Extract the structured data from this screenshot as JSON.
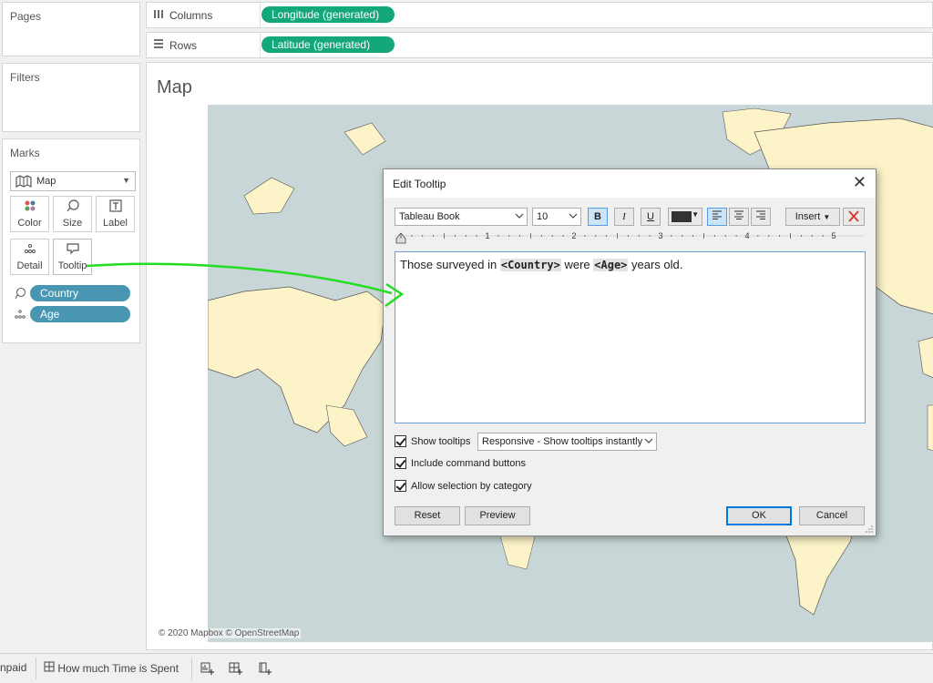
{
  "cards": {
    "pages_title": "Pages",
    "filters_title": "Filters",
    "marks_title": "Marks"
  },
  "marks": {
    "mark_type": "Map",
    "buttons": {
      "color": "Color",
      "size": "Size",
      "label": "Label",
      "detail": "Detail",
      "tooltip": "Tooltip"
    },
    "fields": [
      {
        "name": "Country",
        "encoding": "detail-lasso-icon"
      },
      {
        "name": "Age",
        "encoding": "detail-dots-icon"
      }
    ]
  },
  "shelves": {
    "columns_label": "Columns",
    "columns_pill": "Longitude (generated)",
    "rows_label": "Rows",
    "rows_pill": "Latitude (generated)"
  },
  "viz": {
    "title": "Map",
    "attribution": "© 2020 Mapbox © OpenStreetMap"
  },
  "tabs": {
    "tab1": "npaid",
    "tab2": "How much Time is Spent"
  },
  "dialog": {
    "title": "Edit Tooltip",
    "font": "Tableau Book",
    "font_size": "10",
    "bold": "B",
    "italic": "I",
    "underline": "U",
    "insert": "Insert",
    "ruler_marks": [
      "1",
      "2",
      "3",
      "4",
      "5"
    ],
    "text_parts": {
      "p1": "Those surveyed in ",
      "f1": "<Country>",
      "p2": " were ",
      "f2": "<Age>",
      "p3": " years old."
    },
    "show_tooltips": "Show tooltips",
    "tooltip_mode": "Responsive - Show tooltips instantly",
    "include_command_buttons": "Include command buttons",
    "allow_selection": "Allow selection by category",
    "reset": "Reset",
    "preview": "Preview",
    "ok": "OK",
    "cancel": "Cancel"
  },
  "colors": {
    "pill_blue": "#4996b2",
    "pill_green": "#14a779",
    "annotation_arrow": "#22dd22",
    "map_water": "#c8d6d8",
    "map_land": "#fdf3c8"
  }
}
